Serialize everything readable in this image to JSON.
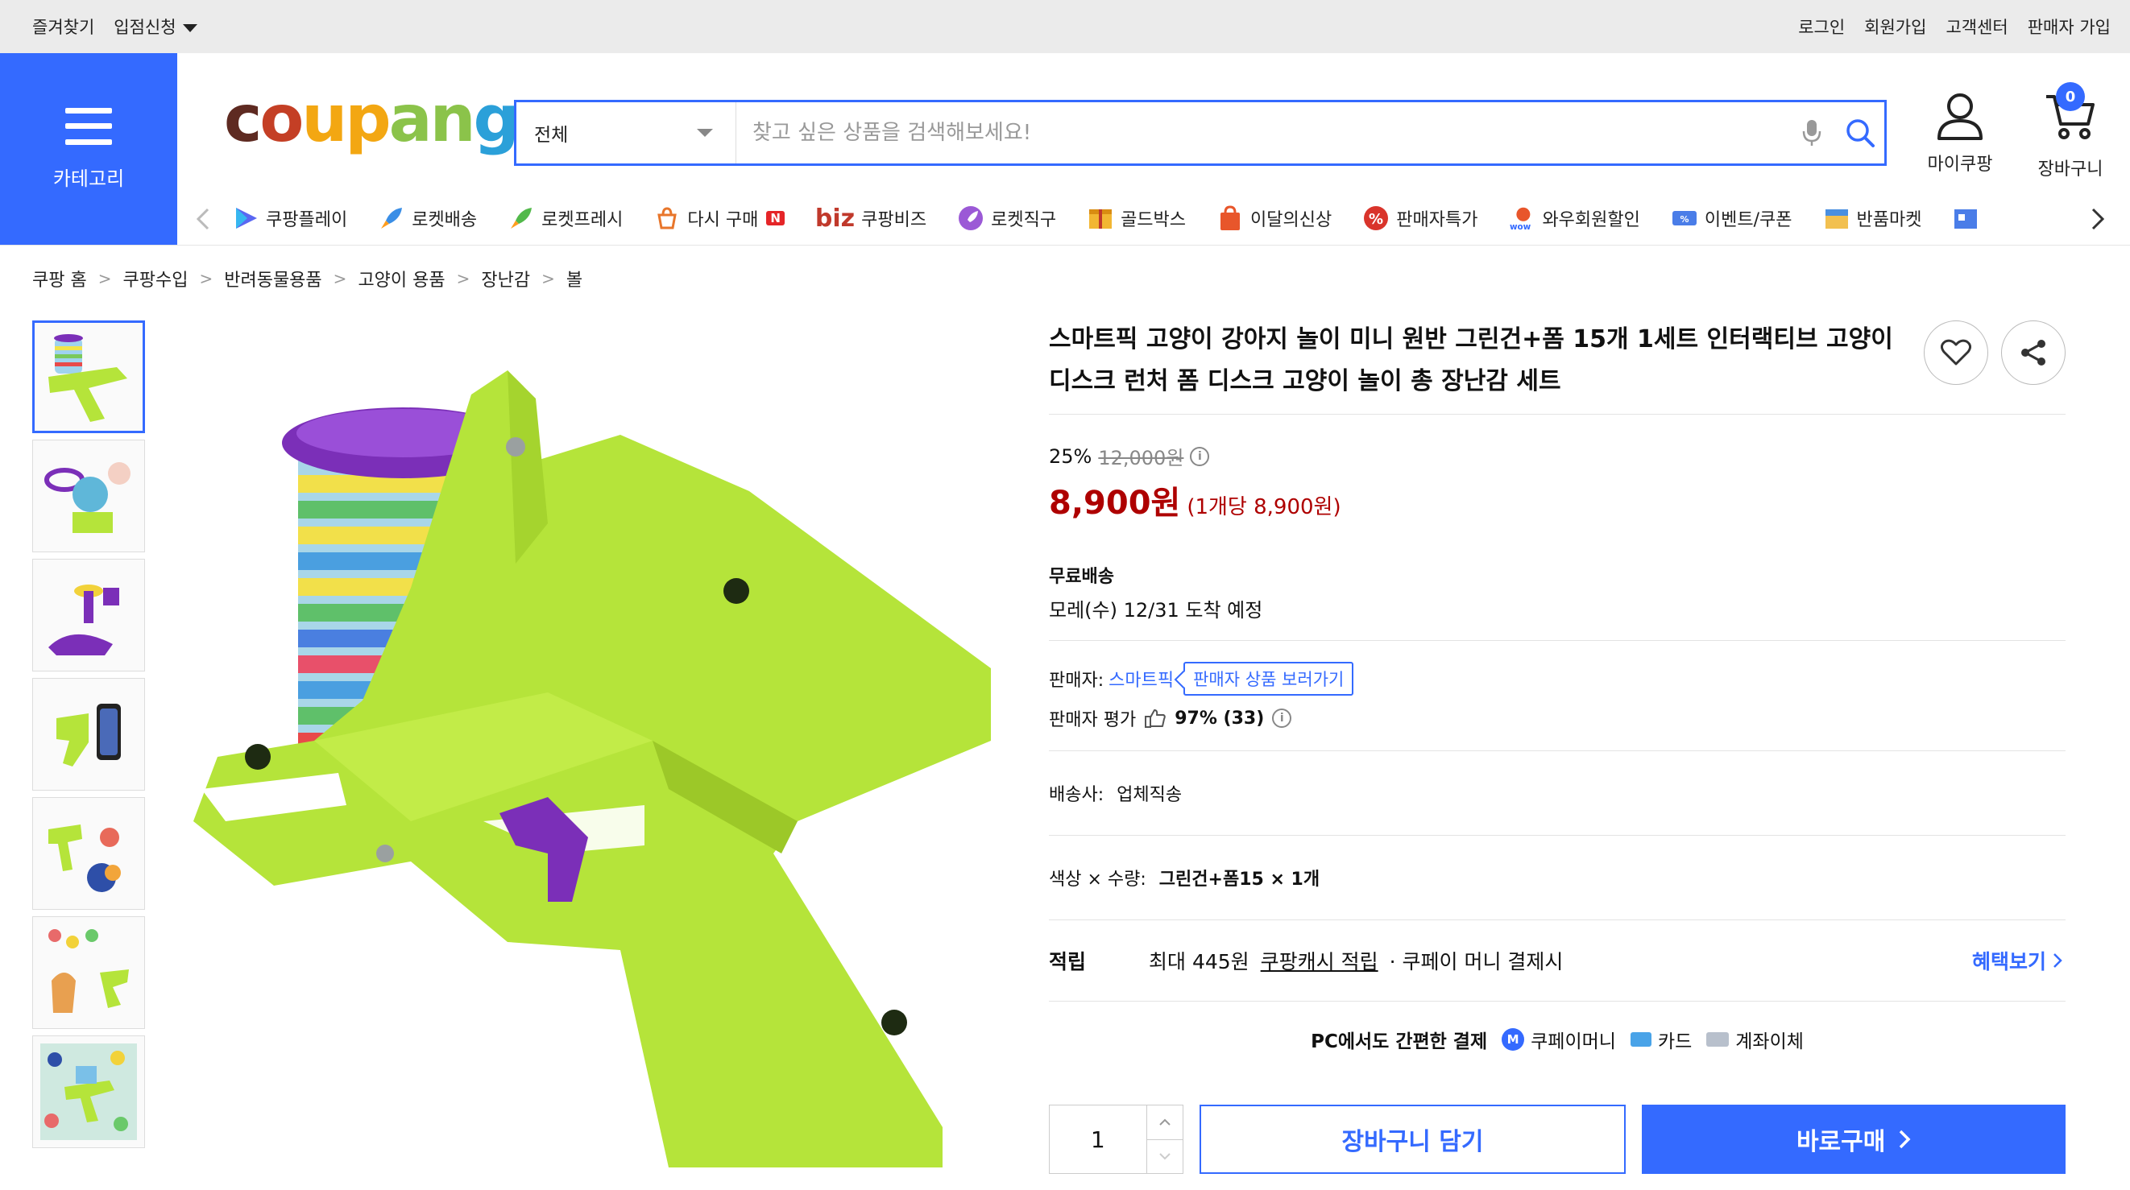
{
  "topbar": {
    "left": [
      "즐겨찾기",
      "입점신청"
    ],
    "right": [
      "로그인",
      "회원가입",
      "고객센터",
      "판매자 가입"
    ]
  },
  "header": {
    "category_label": "카테고리",
    "logo_text": "coupang",
    "search_category": "전체",
    "search_placeholder": "찾고 싶은 상품을 검색해보세요!",
    "my_label": "마이쿠팡",
    "cart_label": "장바구니",
    "cart_count": "0",
    "accent_color": "#346aff"
  },
  "nav": {
    "items": [
      {
        "label": "쿠팡플레이",
        "icon": "play-icon"
      },
      {
        "label": "로켓배송",
        "icon": "rocket-icon"
      },
      {
        "label": "로켓프레시",
        "icon": "rocket-fresh-icon"
      },
      {
        "label": "다시 구매",
        "icon": "rebuy-icon",
        "badge": "N"
      },
      {
        "label": "쿠팡비즈",
        "icon": "biz-icon",
        "prefix": "biz"
      },
      {
        "label": "로켓직구",
        "icon": "global-rocket-icon"
      },
      {
        "label": "골드박스",
        "icon": "goldbox-icon"
      },
      {
        "label": "이달의신상",
        "icon": "new-bag-icon"
      },
      {
        "label": "판매자특가",
        "icon": "percent-icon"
      },
      {
        "label": "와우회원할인",
        "icon": "wow-icon"
      },
      {
        "label": "이벤트/쿠폰",
        "icon": "coupon-icon"
      },
      {
        "label": "반품마켓",
        "icon": "return-market-icon"
      }
    ]
  },
  "breadcrumb": [
    "쿠팡 홈",
    "쿠팡수입",
    "반려동물용품",
    "고양이 용품",
    "장난감",
    "볼"
  ],
  "product": {
    "title": "스마트픽 고양이 강아지 놀이 미니 원반 그린건+폼 15개 1세트 인터랙티브 고양이 디스크 런처 폼 디스크 고양이 놀이 총 장난감 세트",
    "discount_rate": "25%",
    "original_price": "12,000원",
    "sale_price": "8,900원",
    "unit_price": "(1개당 8,900원)",
    "shipping_label": "무료배송",
    "arrival": "모레(수) 12/31 도착 예정",
    "seller_label": "판매자:",
    "seller_name": "스마트픽",
    "seller_more": "판매자 상품 보러가기",
    "seller_rating_label": "판매자 평가",
    "seller_rating": "97% (33)",
    "delivery_label": "배송사:",
    "delivery_value": "업체직송",
    "option_label": "색상 × 수량:",
    "option_value": "그린건+폼15 × 1개",
    "reward_label": "적립",
    "reward_amount": "최대 445원",
    "reward_link": "쿠팡캐시 적립",
    "reward_cond": "· 쿠페이 머니 결제시",
    "benefit_label": "혜택보기",
    "pay_title": "PC에서도 간편한 결제",
    "pay_methods": [
      "쿠페이머니",
      "카드",
      "계좌이체"
    ],
    "quantity": "1",
    "add_cart": "장바구니 담기",
    "buy_now": "바로구매"
  },
  "colors": {
    "price_red": "#ae0000",
    "gun_green": "#b5e43a",
    "accent_purple": "#7b2fb8"
  }
}
